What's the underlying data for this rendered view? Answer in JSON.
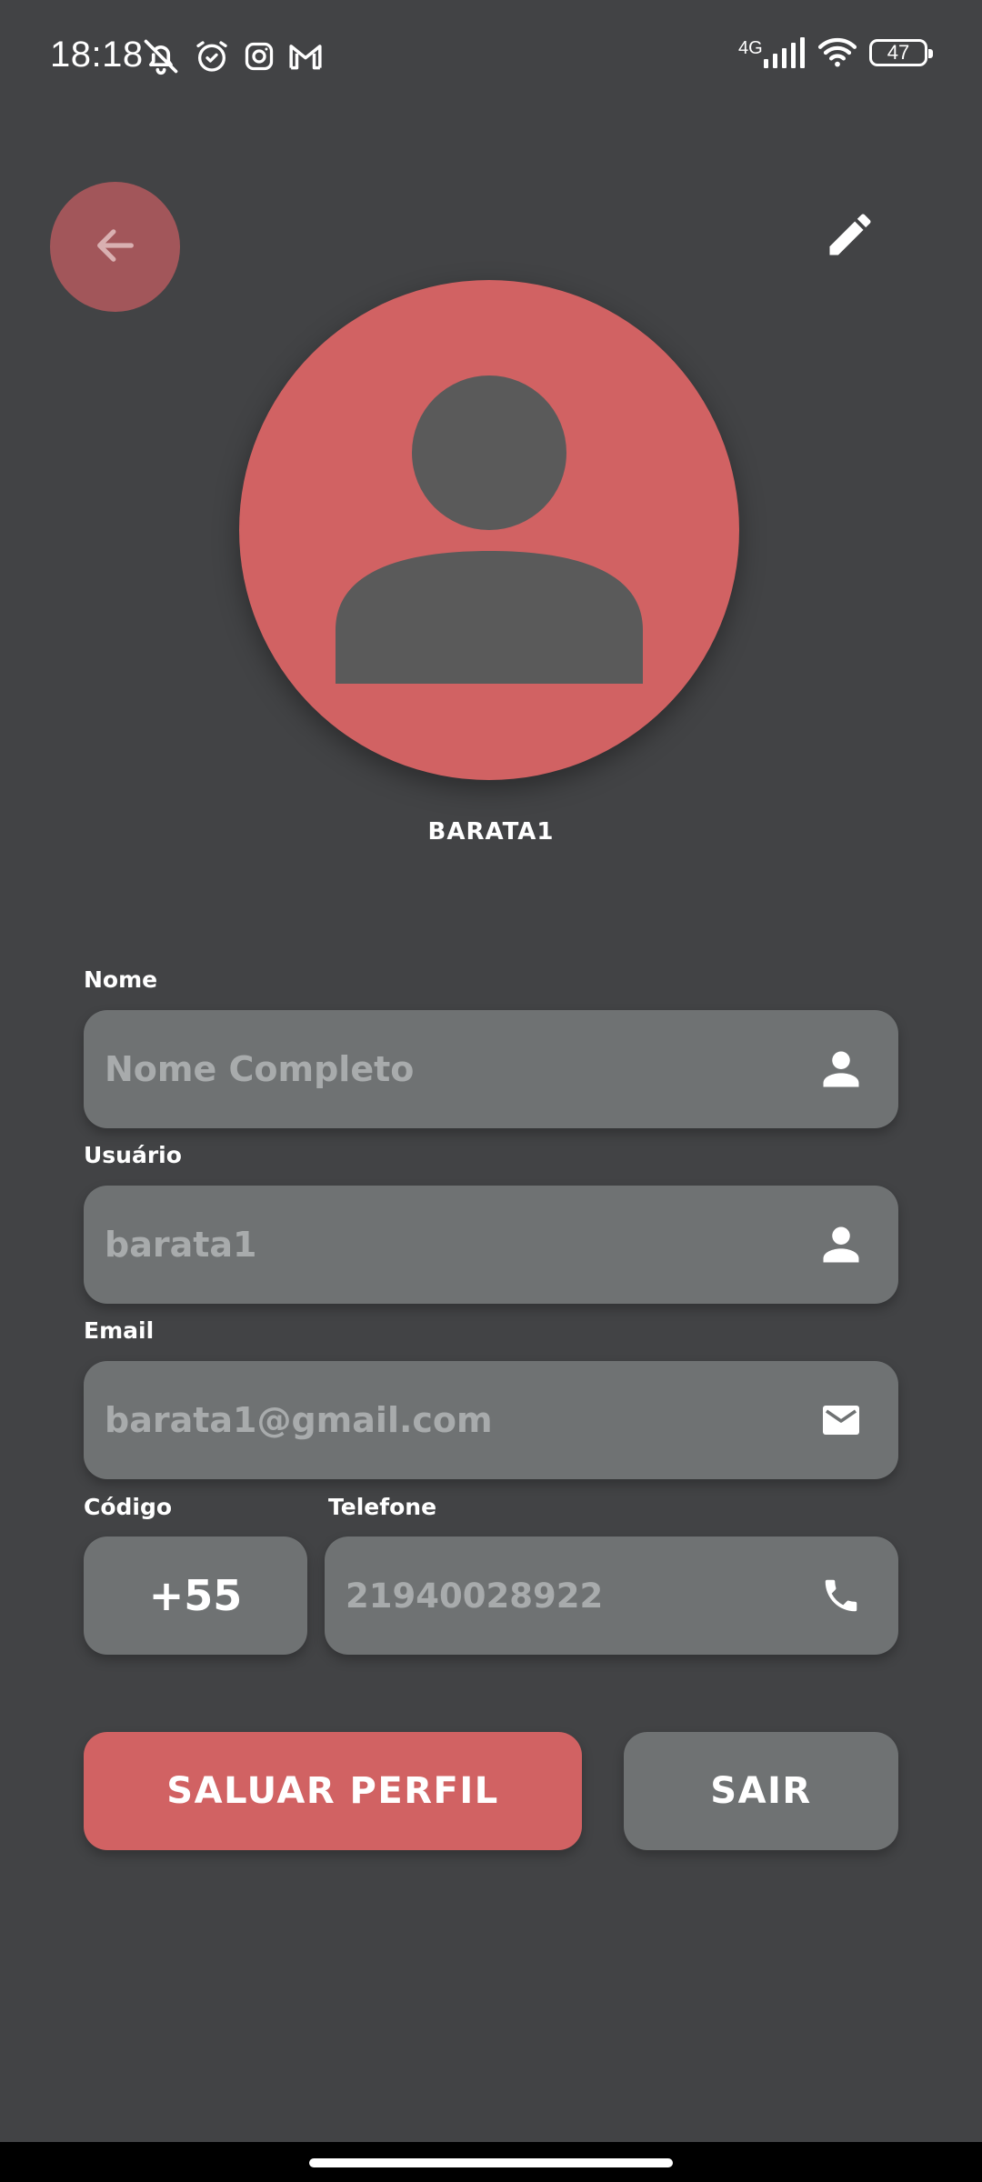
{
  "status_bar": {
    "time": "18:18",
    "network": "4G",
    "battery": "47",
    "icons": [
      "bell-off-icon",
      "alarm-icon",
      "instagram-icon",
      "gmail-icon",
      "signal-icon",
      "wifi-icon",
      "battery-icon"
    ]
  },
  "header": {
    "back_icon": "arrow-left-icon",
    "edit_icon": "pencil-icon"
  },
  "profile": {
    "avatar_icon": "person-placeholder-icon",
    "username_caption": "BARATA1"
  },
  "form": {
    "name": {
      "label": "Nome",
      "placeholder": "Nome Completo",
      "value": "",
      "icon": "person-icon"
    },
    "user": {
      "label": "Usuário",
      "value": "barata1",
      "icon": "person-icon"
    },
    "email": {
      "label": "Email",
      "value": "barata1@gmail.com",
      "icon": "mail-icon"
    },
    "code": {
      "label": "Código",
      "value": "+55"
    },
    "phone": {
      "label": "Telefone",
      "value": "21940028922",
      "icon": "phone-icon"
    }
  },
  "actions": {
    "save_label": "SALUAR PERFIL",
    "exit_label": "SAIR"
  },
  "colors": {
    "background": "#424345",
    "accent": "#d16263",
    "field": "#6f7273",
    "back_button": "#a2565a",
    "field_text": "#a8abac"
  }
}
